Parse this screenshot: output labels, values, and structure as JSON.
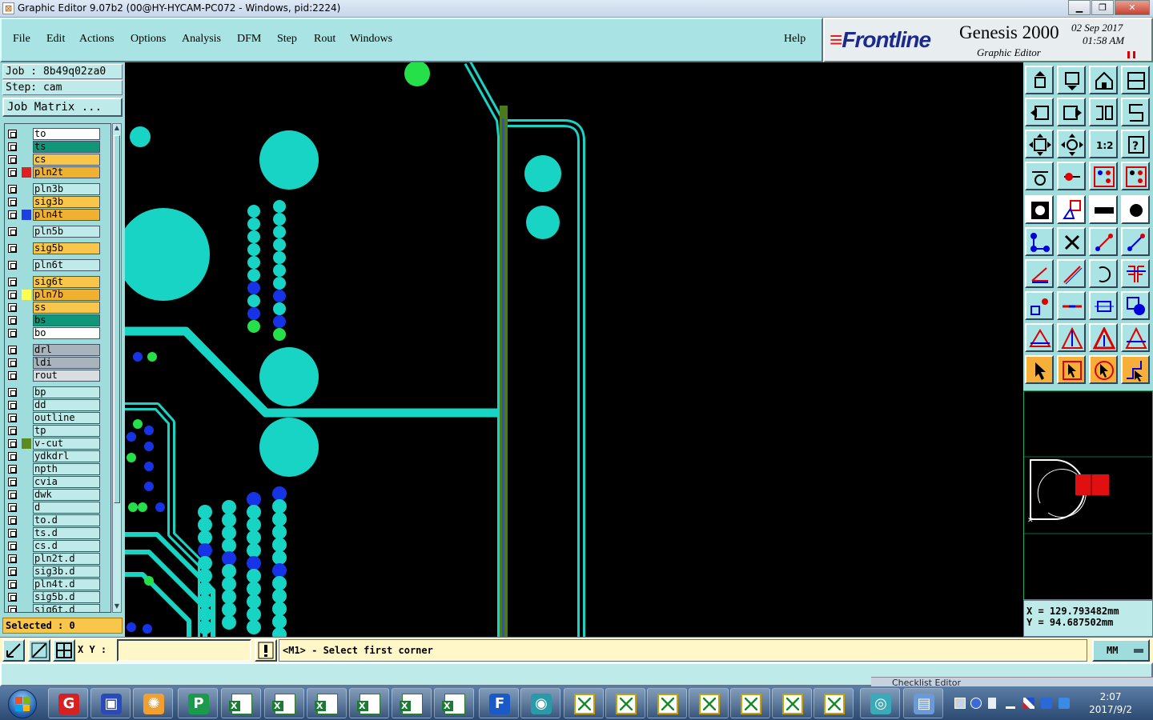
{
  "window": {
    "title": "Graphic Editor 9.07b2 (00@HY-HYCAM-PC072 - Windows, pid:2224)",
    "min_label": "▁",
    "max_label": "❐",
    "close_label": "✕"
  },
  "menu": {
    "items": [
      "File",
      "Edit",
      "Actions",
      "Options",
      "Analysis",
      "DFM",
      "Step",
      "Rout",
      "Windows"
    ],
    "help": "Help"
  },
  "brand": {
    "logo_lines": "≡",
    "logo": "Frontline",
    "product": "Genesis 2000",
    "subtitle": "Graphic Editor",
    "date": "02  Sep  2017",
    "time": "01:58  AM"
  },
  "left": {
    "job": "Job  : 8b49q02za0",
    "step": "Step: cam",
    "job_matrix": "Job Matrix ...",
    "selected": "Selected : 0",
    "layers": [
      {
        "name": "to",
        "bg": "#ffffff",
        "sw": ""
      },
      {
        "name": "ts",
        "bg": "#12967a",
        "sw": ""
      },
      {
        "name": "cs",
        "bg": "#f8c64a",
        "sw": ""
      },
      {
        "name": "pln2t",
        "bg": "#f0b030",
        "sw": "#e02020"
      },
      {
        "name": "pln3b",
        "bg": "#bfeaea",
        "sw": ""
      },
      {
        "name": "sig3b",
        "bg": "#f8c64a",
        "sw": ""
      },
      {
        "name": "pln4t",
        "bg": "#f0b030",
        "sw": "#1e40e0"
      },
      {
        "name": "pln5b",
        "bg": "#bfeaea",
        "sw": ""
      },
      {
        "name": "sig5b",
        "bg": "#f8c64a",
        "sw": ""
      },
      {
        "name": "pln6t",
        "bg": "#bfeaea",
        "sw": ""
      },
      {
        "name": "sig6t",
        "bg": "#f8c64a",
        "sw": ""
      },
      {
        "name": "pln7b",
        "bg": "#f0b030",
        "sw": "#ffff50"
      },
      {
        "name": "ss",
        "bg": "#f8c64a",
        "sw": ""
      },
      {
        "name": "bs",
        "bg": "#12967a",
        "sw": ""
      },
      {
        "name": "bo",
        "bg": "#ffffff",
        "sw": ""
      },
      {
        "name": "drl",
        "bg": "#a8b4bc",
        "sw": ""
      },
      {
        "name": "ldi",
        "bg": "#a8b4bc",
        "sw": ""
      },
      {
        "name": "rout",
        "bg": "#d8dde0",
        "sw": ""
      },
      {
        "name": "bp",
        "bg": "#bfeaea",
        "sw": ""
      },
      {
        "name": "dd",
        "bg": "#bfeaea",
        "sw": ""
      },
      {
        "name": "outline",
        "bg": "#bfeaea",
        "sw": ""
      },
      {
        "name": "tp",
        "bg": "#bfeaea",
        "sw": ""
      },
      {
        "name": "v-cut",
        "bg": "#bfeaea",
        "sw": "#5a8a20"
      },
      {
        "name": "ydkdrl",
        "bg": "#bfeaea",
        "sw": ""
      },
      {
        "name": "npth",
        "bg": "#bfeaea",
        "sw": ""
      },
      {
        "name": "cvia",
        "bg": "#bfeaea",
        "sw": ""
      },
      {
        "name": "dwk",
        "bg": "#bfeaea",
        "sw": ""
      },
      {
        "name": "d",
        "bg": "#bfeaea",
        "sw": ""
      },
      {
        "name": "to.d",
        "bg": "#bfeaea",
        "sw": ""
      },
      {
        "name": "ts.d",
        "bg": "#bfeaea",
        "sw": ""
      },
      {
        "name": "cs.d",
        "bg": "#bfeaea",
        "sw": ""
      },
      {
        "name": "pln2t.d",
        "bg": "#bfeaea",
        "sw": ""
      },
      {
        "name": "sig3b.d",
        "bg": "#bfeaea",
        "sw": ""
      },
      {
        "name": "pln4t.d",
        "bg": "#bfeaea",
        "sw": ""
      },
      {
        "name": "sig5b.d",
        "bg": "#bfeaea",
        "sw": ""
      },
      {
        "name": "sig6t.d",
        "bg": "#bfeaea",
        "sw": ""
      }
    ]
  },
  "coords": {
    "x": "X  =  129.793482mm",
    "y": "Y  =  94.687502mm"
  },
  "command": {
    "xy_label": "X Y :",
    "xy_value": "",
    "prompt": "<M1> - Select first corner",
    "units": "MM"
  },
  "ghost_window": "Checklist Editor",
  "taskbar": {
    "clock_time": "2:07",
    "clock_date": "2017/9/2"
  },
  "colors": {
    "copper": "#17d4c4",
    "via_blue": "#1634e6",
    "via_green": "#26e04a",
    "vcut_green": "#4a7a1a",
    "trace_blue": "#3a4ad8",
    "panel": "#9fdcdc"
  }
}
